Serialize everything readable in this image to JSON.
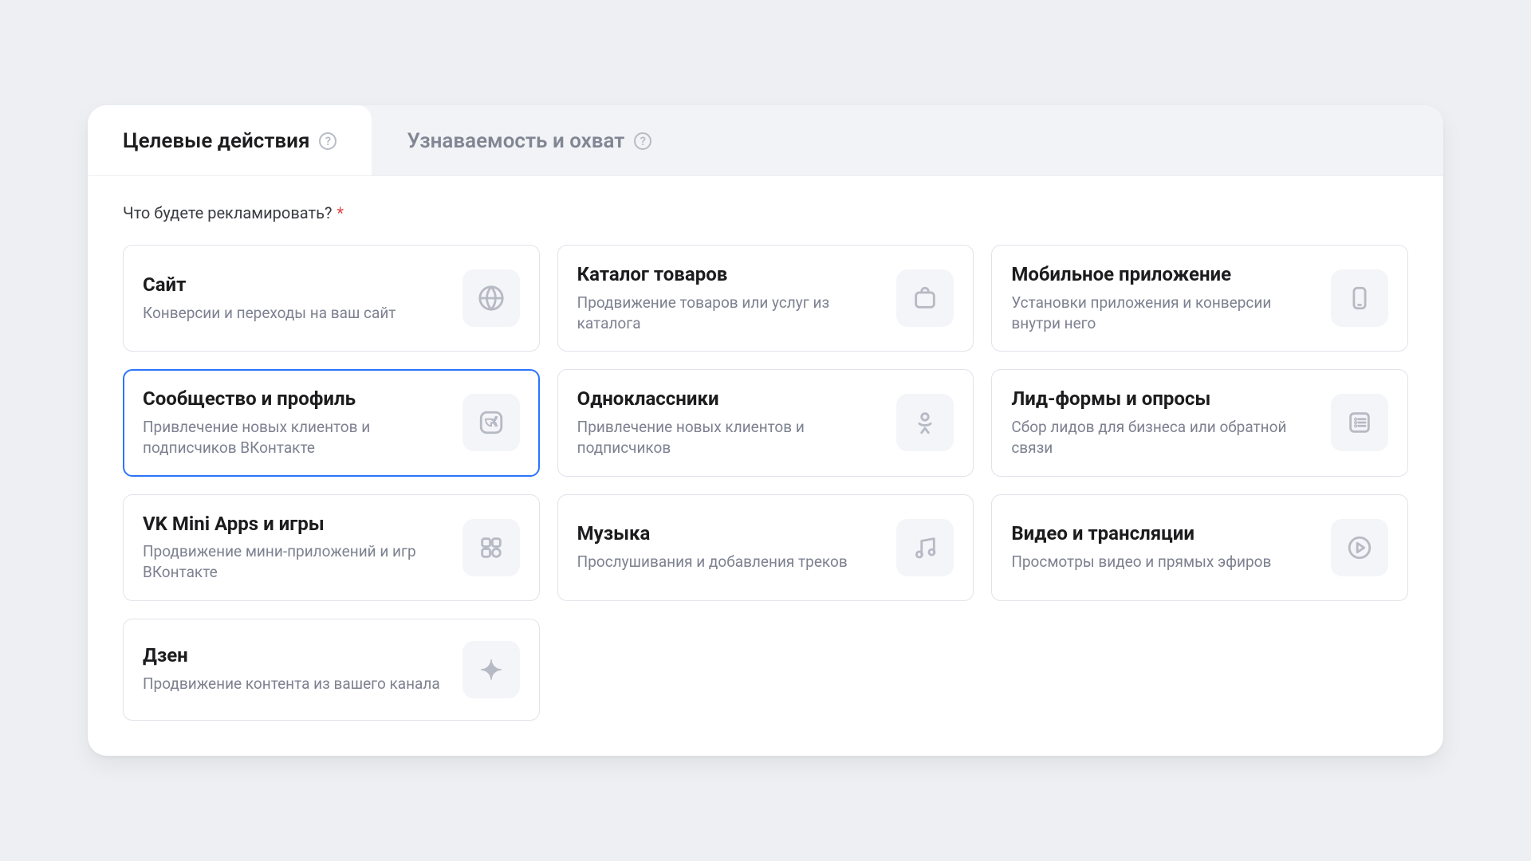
{
  "tabs": [
    {
      "label": "Целевые действия",
      "active": true
    },
    {
      "label": "Узнаваемость и охват",
      "active": false
    }
  ],
  "question": "Что будете рекламировать?",
  "required_mark": "*",
  "cards": [
    {
      "id": "site",
      "title": "Сайт",
      "desc": "Конверсии и переходы на ваш сайт",
      "icon": "globe-icon",
      "selected": false
    },
    {
      "id": "catalog",
      "title": "Каталог товаров",
      "desc": "Продвижение товаров или услуг из каталога",
      "icon": "bag-icon",
      "selected": false
    },
    {
      "id": "mobile",
      "title": "Мобильное приложение",
      "desc": "Установки приложения и конверсии внутри него",
      "icon": "smartphone-icon",
      "selected": false
    },
    {
      "id": "community",
      "title": "Сообщество и профиль",
      "desc": "Привлечение новых клиентов и подписчиков ВКонтакте",
      "icon": "vk-icon",
      "selected": true
    },
    {
      "id": "ok",
      "title": "Одноклассники",
      "desc": "Привлечение новых клиентов и подписчиков",
      "icon": "ok-icon",
      "selected": false
    },
    {
      "id": "leadforms",
      "title": "Лид-формы и опросы",
      "desc": "Сбор лидов для бизнеса или обратной связи",
      "icon": "form-icon",
      "selected": false
    },
    {
      "id": "miniapps",
      "title": "VK Mini Apps и игры",
      "desc": "Продвижение мини-приложений и игр ВКонтакте",
      "icon": "apps-icon",
      "selected": false
    },
    {
      "id": "music",
      "title": "Музыка",
      "desc": "Прослушивания и добавления треков",
      "icon": "music-icon",
      "selected": false
    },
    {
      "id": "video",
      "title": "Видео и трансляции",
      "desc": "Просмотры видео и прямых эфиров",
      "icon": "play-icon",
      "selected": false
    },
    {
      "id": "dzen",
      "title": "Дзен",
      "desc": "Продвижение контента из вашего канала",
      "icon": "dzen-icon",
      "selected": false
    }
  ]
}
